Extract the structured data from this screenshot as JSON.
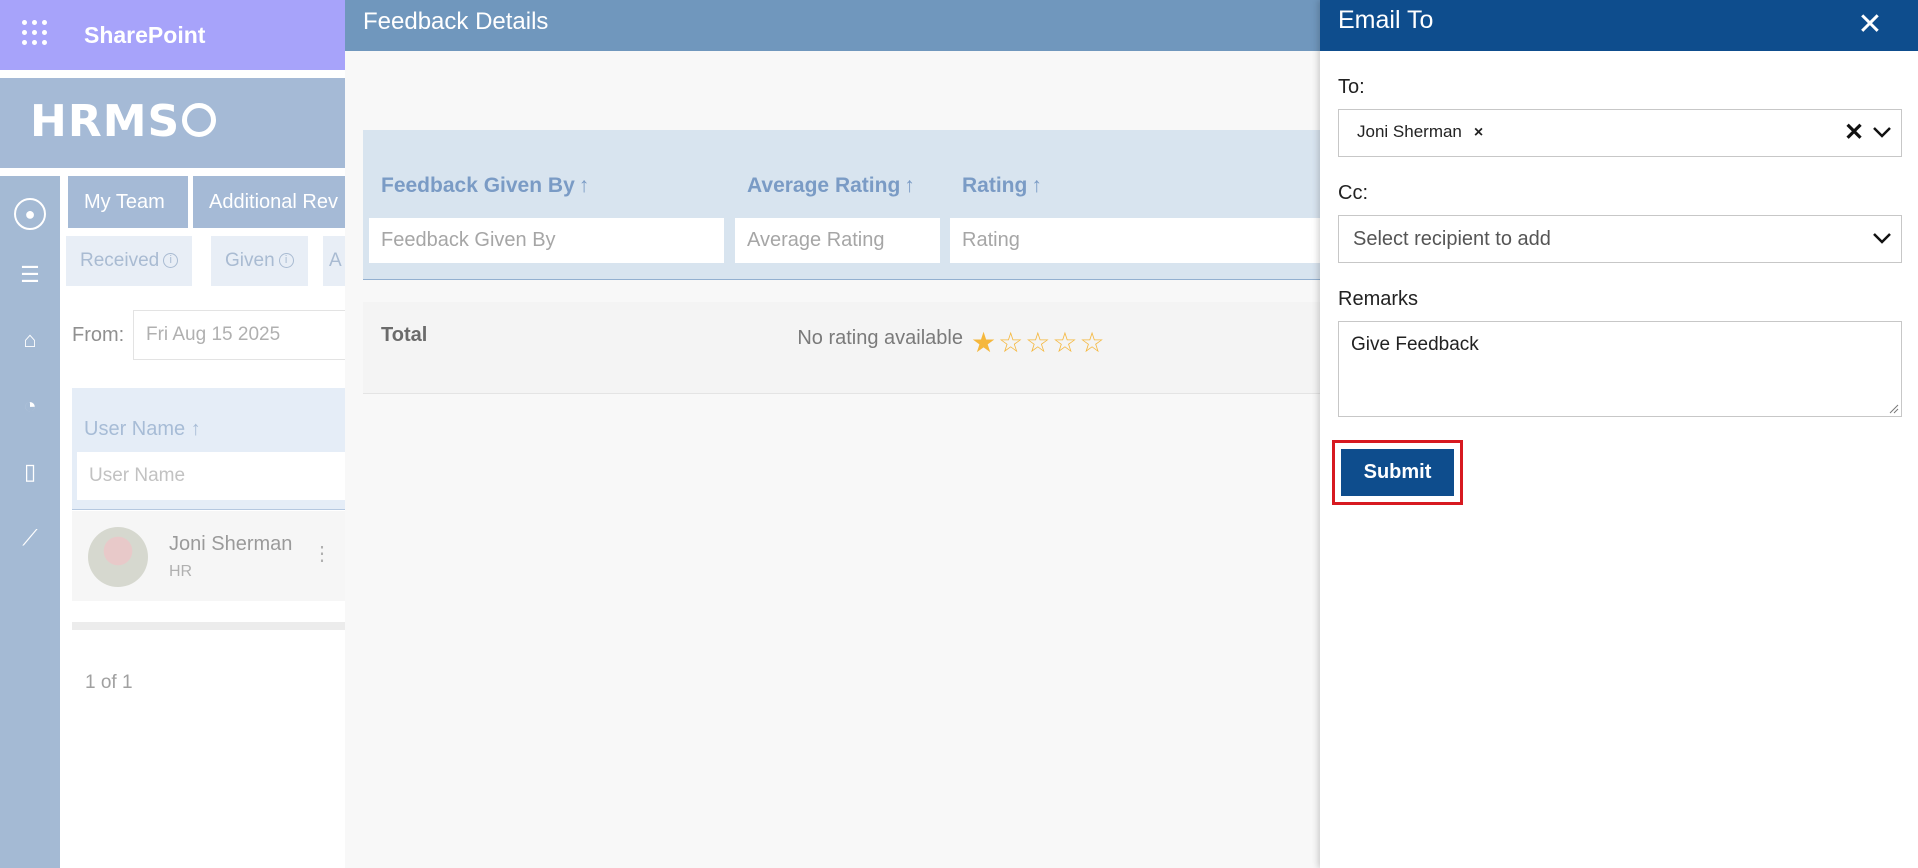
{
  "suite_bar": {
    "app_title": "SharePoint"
  },
  "hrms": {
    "logo_text": "HRMS"
  },
  "background": {
    "tabs": [
      "My Team",
      "Additional Rev"
    ],
    "sub_tabs": [
      "Received",
      "Given",
      "A"
    ],
    "info_glyph": "i",
    "from_label": "From:",
    "from_value": "Fri Aug 15 2025",
    "user_grid": {
      "column": "User Name",
      "sort_glyph": "↑",
      "filter_placeholder": "User Name",
      "row": {
        "name": "Joni Sherman",
        "dept": "HR"
      }
    },
    "pager": "1 of 1"
  },
  "feedback_panel": {
    "title": "Feedback Details",
    "columns": [
      {
        "label": "Feedback Given By",
        "filter": "Feedback Given By"
      },
      {
        "label": "Average Rating",
        "filter": "Average Rating"
      },
      {
        "label": "Rating",
        "filter": "Rating"
      }
    ],
    "sort_glyph": "↑",
    "total_row": {
      "label": "Total",
      "average": "No rating available",
      "rating_value": 1,
      "rating_max": 5
    },
    "colors": {
      "star": "#f5b73c",
      "header": "#7097bd"
    }
  },
  "email_panel": {
    "title": "Email To",
    "close_glyph": "✕",
    "to_label": "To:",
    "to_recipient": "Joni Sherman",
    "chip_remove_glyph": "×",
    "clear_glyph": "✕",
    "cc_label": "Cc:",
    "cc_placeholder": "Select recipient to add",
    "remarks_label": "Remarks",
    "remarks_value": "Give Feedback",
    "submit_label": "Submit",
    "colors": {
      "header": "#0e4d8d",
      "highlight": "#d71920"
    }
  }
}
